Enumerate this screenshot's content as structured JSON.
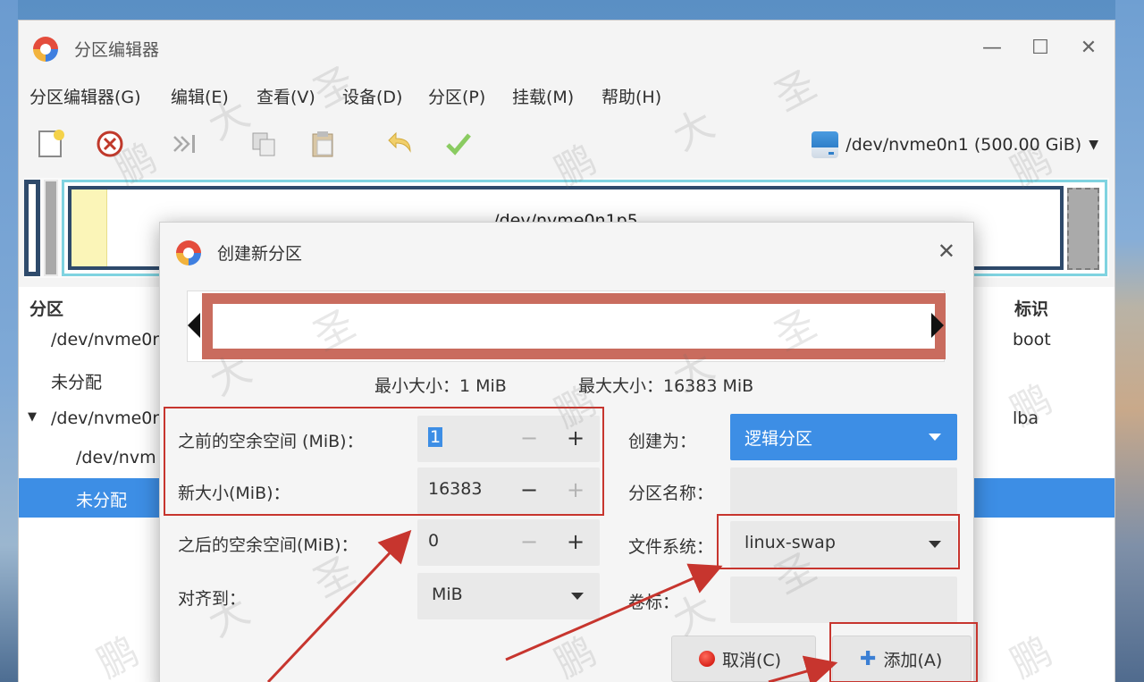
{
  "window": {
    "title": "分区编辑器"
  },
  "window_buttons": {
    "minimize": "—",
    "maximize": "☐",
    "close": "✕"
  },
  "menu": [
    "分区编辑器(G)",
    "编辑(E)",
    "查看(V)",
    "设备(D)",
    "分区(P)",
    "挂载(M)",
    "帮助(H)"
  ],
  "toolbar": {
    "icons": [
      "new-icon",
      "delete-icon",
      "resize-move-icon",
      "copy-icon",
      "paste-icon",
      "undo-icon",
      "apply-icon"
    ],
    "device": "/dev/nvme0n1 (500.00 GiB)"
  },
  "partition_bar": {
    "selected_label": "/dev/nvme0n1p5"
  },
  "list": {
    "columns": [
      "分区",
      "标识"
    ],
    "rows": [
      {
        "name": "/dev/nvme0r",
        "flag": "boot"
      },
      {
        "name": "未分配",
        "flag": ""
      },
      {
        "name": "/dev/nvme0r",
        "flag": "lba"
      },
      {
        "name": "/dev/nvm",
        "flag": ""
      },
      {
        "name": "未分配",
        "flag": ""
      }
    ]
  },
  "dialog": {
    "title": "创建新分区",
    "close": "✕",
    "min_size": "最小大小：1 MiB",
    "max_size": "最大大小：16383 MiB",
    "fields": {
      "free_before": {
        "label": "之前的空余空间 (MiB)：",
        "value": "1"
      },
      "new_size": {
        "label": "新大小(MiB)：",
        "value": "16383"
      },
      "free_after": {
        "label": "之后的空余空间(MiB)：",
        "value": "0"
      },
      "align": {
        "label": "对齐到：",
        "value": "MiB"
      },
      "create_as": {
        "label": "创建为：",
        "value": "逻辑分区"
      },
      "partition_name": {
        "label": "分区名称：",
        "value": ""
      },
      "filesystem": {
        "label": "文件系统：",
        "value": "linux-swap"
      },
      "volume_label": {
        "label": "卷标：",
        "value": ""
      }
    },
    "cancel": "取消(C)",
    "add": "添加(A)"
  },
  "colors": {
    "accent": "#3d8ee5",
    "annotation": "#c7352e",
    "resizer_bar": "#c96c5e",
    "partition_border": "#2e4a6b",
    "partition_highlight": "#7fd3e0"
  },
  "watermark": [
    "鹏",
    "大",
    "圣"
  ]
}
